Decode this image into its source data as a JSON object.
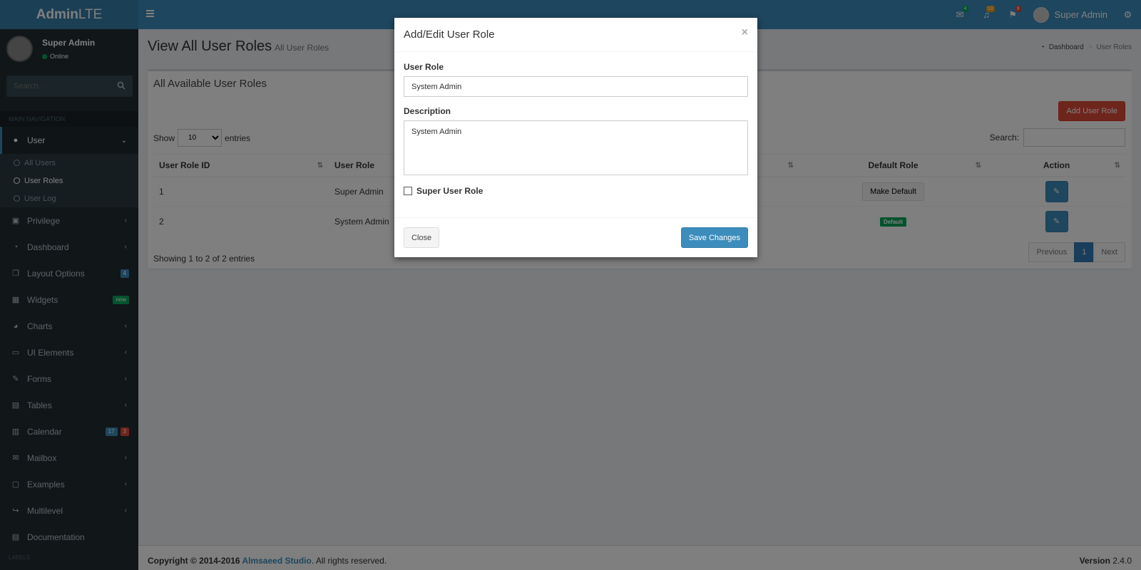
{
  "header": {
    "logo_bold": "Admin",
    "logo_light": "LTE",
    "mail_count": "4",
    "bell_count": "10",
    "flag_count": "9",
    "user_name": "Super Admin",
    "colors": {
      "bar": "#3c8dbc",
      "logo_bg": "#367fa9"
    }
  },
  "sidebar": {
    "user_name": "Super Admin",
    "status": "Online",
    "search_placeholder": "Search...",
    "nav_header": "MAIN NAVIGATION",
    "labels_header": "LABELS",
    "items": [
      {
        "label": "User",
        "icon": "user-icon",
        "active": true
      },
      {
        "label": "Privilege",
        "icon": "lock-icon"
      },
      {
        "label": "Dashboard",
        "icon": "dashboard-icon"
      },
      {
        "label": "Layout Options",
        "icon": "files-icon",
        "badge": "4"
      },
      {
        "label": "Widgets",
        "icon": "grid-icon",
        "badge": "new"
      },
      {
        "label": "Charts",
        "icon": "pie-chart-icon"
      },
      {
        "label": "UI Elements",
        "icon": "laptop-icon"
      },
      {
        "label": "Forms",
        "icon": "edit-icon"
      },
      {
        "label": "Tables",
        "icon": "table-icon"
      },
      {
        "label": "Calendar",
        "icon": "calendar-icon",
        "badge1": "17",
        "badge2": "3"
      },
      {
        "label": "Mailbox",
        "icon": "envelope-icon"
      },
      {
        "label": "Examples",
        "icon": "folder-icon"
      },
      {
        "label": "Multilevel",
        "icon": "share-icon"
      },
      {
        "label": "Documentation",
        "icon": "book-icon"
      }
    ],
    "submenu": [
      "All Users",
      "User Roles",
      "User Log"
    ]
  },
  "content": {
    "title": "View All User Roles",
    "subtitle": "All User Roles",
    "breadcrumb": [
      "Dashboard",
      "User Roles"
    ],
    "box_title": "All Available User Roles",
    "add_button": "Add User Role",
    "show_label": "Show",
    "entries_value": "10",
    "entries_label": "entries",
    "search_label": "Search:",
    "columns": [
      "User Role ID",
      "User Role",
      "Default Role",
      "Action"
    ],
    "rows": [
      {
        "id": "1",
        "role": "Super Admin",
        "default_button": "Make Default"
      },
      {
        "id": "2",
        "role": "System Admin",
        "default_label": "Default"
      }
    ],
    "info": "Showing 1 to 2 of 2 entries",
    "pager": {
      "prev": "Previous",
      "page": "1",
      "next": "Next"
    }
  },
  "footer": {
    "copy_prefix": "Copyright © 2014-2016 ",
    "company": "Almsaeed Studio",
    "copy_suffix": ". All rights reserved.",
    "version_label": "Version",
    "version": "2.4.0"
  },
  "modal": {
    "title": "Add/Edit User Role",
    "close_x": "×",
    "role_label": "User Role",
    "role_value": "System Admin",
    "description_label": "Description",
    "description_value": "System Admin",
    "checkbox_label": "Super User Role",
    "close_button": "Close",
    "save_button": "Save Changes"
  }
}
